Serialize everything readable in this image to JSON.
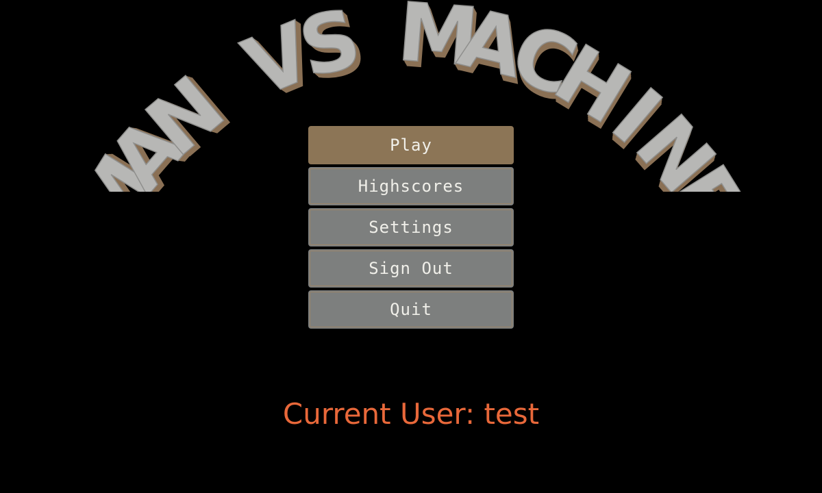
{
  "title": {
    "text": "MAN VS MACHINE",
    "face_color": "#b7b7b5",
    "side_color": "#8a7055"
  },
  "menu": {
    "buttons": [
      {
        "label": "Play",
        "name": "play-button"
      },
      {
        "label": "Highscores",
        "name": "highscores-button"
      },
      {
        "label": "Settings",
        "name": "settings-button"
      },
      {
        "label": "Sign Out",
        "name": "sign-out-button"
      },
      {
        "label": "Quit",
        "name": "quit-button"
      }
    ]
  },
  "status": {
    "current_user": "Current User: test"
  },
  "colors": {
    "background": "#000000",
    "primary_button": "#8c7556",
    "button": "#7d7f7e",
    "status_text": "#e8683a"
  }
}
